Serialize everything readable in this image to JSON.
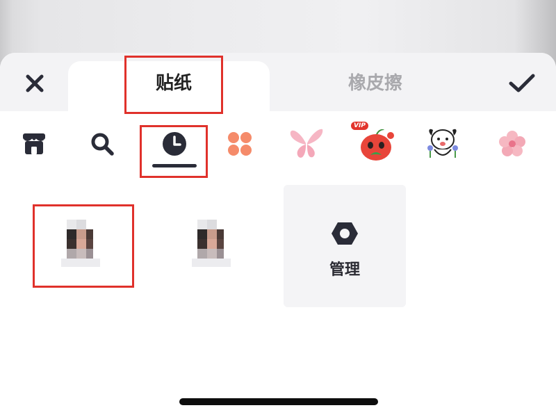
{
  "tabs": {
    "stickers_label": "贴纸",
    "eraser_label": "橡皮擦"
  },
  "category_icons": [
    "store-icon",
    "search-icon",
    "clock-icon",
    "four-petal-icon",
    "butterfly-icon",
    "apple-vip-icon",
    "dog-sticker-icon",
    "flower-icon"
  ],
  "vip_badge": "VIP",
  "manage": {
    "label": "管理"
  },
  "colors": {
    "accent_dark": "#2a2c38",
    "highlight_red": "#e0312b",
    "inactive_text": "#a9a9ad",
    "petal_orange": "#f58b6a",
    "butterfly_pink": "#f6b6c4"
  }
}
